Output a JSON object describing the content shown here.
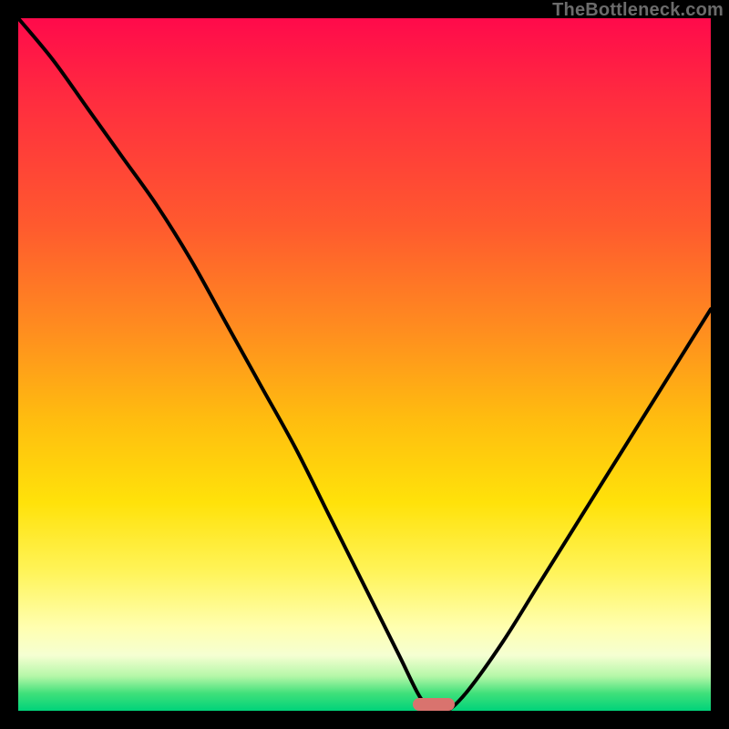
{
  "watermark": "TheBottleneck.com",
  "colors": {
    "frame_bg": "#000000",
    "gradient_top": "#ff0a4b",
    "gradient_bottom": "#00d37a",
    "curve_stroke": "#000000",
    "marker_fill": "#d9736e",
    "watermark_fg": "#6b6b6b"
  },
  "chart_data": {
    "type": "line",
    "title": "",
    "xlabel": "",
    "ylabel": "",
    "xlim": [
      0,
      100
    ],
    "ylim": [
      0,
      100
    ],
    "grid": false,
    "legend": false,
    "series": [
      {
        "name": "bottleneck-curve",
        "x": [
          0,
          5,
          10,
          15,
          20,
          25,
          30,
          35,
          40,
          45,
          50,
          55,
          58,
          60,
          62,
          65,
          70,
          75,
          80,
          85,
          90,
          95,
          100
        ],
        "y": [
          100,
          94,
          87,
          80,
          73,
          65,
          56,
          47,
          38,
          28,
          18,
          8,
          2,
          0,
          0,
          3,
          10,
          18,
          26,
          34,
          42,
          50,
          58
        ]
      }
    ],
    "optimum_marker": {
      "x_center": 60,
      "width_pct": 6,
      "y": 0
    },
    "notes": "V-shaped black curve on a vertical heat gradient from red (high bottleneck) at top to green (low bottleneck) at bottom; a small rounded salmon marker sits at the valley on the baseline."
  }
}
